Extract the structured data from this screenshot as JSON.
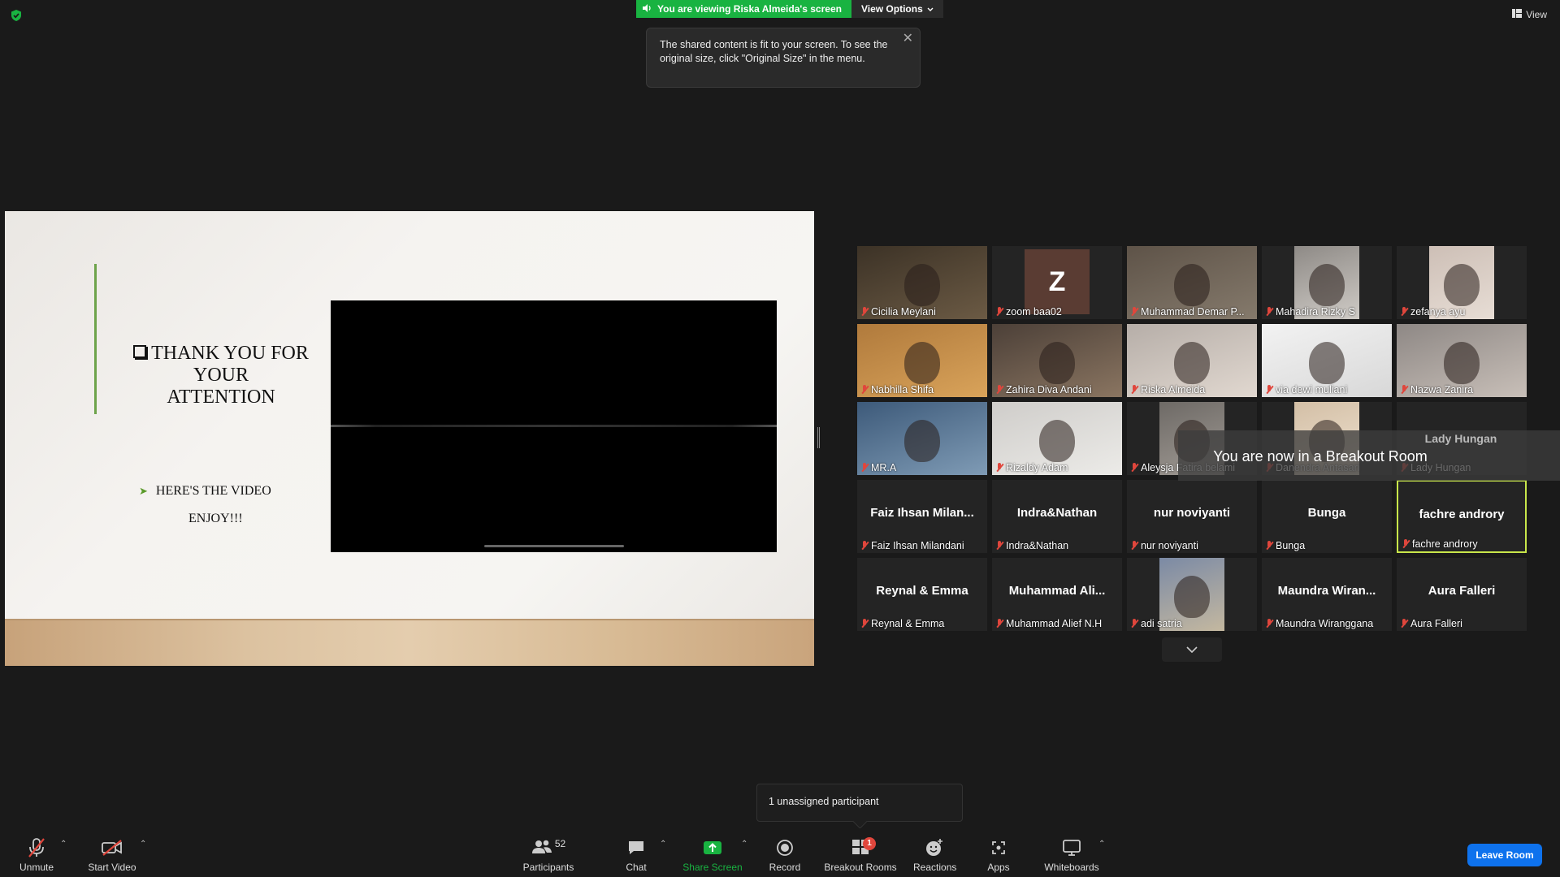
{
  "top": {
    "banner_text": "You are viewing Riska Almeida's screen",
    "view_options_label": "View Options",
    "view_label": "View"
  },
  "tooltip": {
    "text": "The shared content is fit to your screen. To see the original size, click \"Original Size\" in the menu."
  },
  "slide": {
    "title_lines": [
      "THANK YOU FOR",
      "YOUR",
      "ATTENTION"
    ],
    "bullet_text": "HERE'S THE VIDEO",
    "enjoy_text": "ENJOY!!!"
  },
  "gallery": {
    "participants": [
      {
        "name": "Cicilia Meylani",
        "kind": "video"
      },
      {
        "name": "zoom baa02",
        "kind": "letter",
        "letter": "Z"
      },
      {
        "name": "Muhammad Demar P...",
        "kind": "video"
      },
      {
        "name": "Mahadira Rizky S",
        "kind": "video"
      },
      {
        "name": "zefanya ayu",
        "kind": "video"
      },
      {
        "name": "Nabhilla Shifa",
        "kind": "video"
      },
      {
        "name": "Zahira Diva Andani",
        "kind": "video"
      },
      {
        "name": "Riska Almeida",
        "kind": "video"
      },
      {
        "name": "via dewi muliani",
        "kind": "video"
      },
      {
        "name": "Nazwa Zanira",
        "kind": "video"
      },
      {
        "name": "MR.A",
        "kind": "video"
      },
      {
        "name": "Rizaldy Adam",
        "kind": "video"
      },
      {
        "name": "Aleysja Fatira belami",
        "kind": "video"
      },
      {
        "name": "Danendra Antasari",
        "kind": "video"
      },
      {
        "name": "Lady Hungan",
        "kind": "text",
        "big": "Lady Hungan"
      },
      {
        "name": "Faiz Ihsan Milandani",
        "kind": "text",
        "big": "Faiz Ihsan Milan..."
      },
      {
        "name": "Indra&Nathan",
        "kind": "text",
        "big": "Indra&Nathan"
      },
      {
        "name": "nur noviyanti",
        "kind": "text",
        "big": "nur noviyanti"
      },
      {
        "name": "Bunga",
        "kind": "text",
        "big": "Bunga"
      },
      {
        "name": "fachre androry",
        "kind": "text",
        "big": "fachre androry",
        "active": true
      },
      {
        "name": "Reynal & Emma",
        "kind": "text",
        "big": "Reynal & Emma"
      },
      {
        "name": "Muhammad Alief N.H",
        "kind": "text",
        "big": "Muhammad Ali..."
      },
      {
        "name": "adi satria",
        "kind": "video"
      },
      {
        "name": "Maundra Wiranggana",
        "kind": "text",
        "big": "Maundra Wiran..."
      },
      {
        "name": "Aura Falleri",
        "kind": "text",
        "big": "Aura Falleri"
      }
    ],
    "breakout_message": "You are now in a Breakout Room"
  },
  "unassigned": {
    "text": "1 unassigned participant"
  },
  "toolbar": {
    "unmute": "Unmute",
    "start_video": "Start Video",
    "participants": "Participants",
    "participants_count": "52",
    "chat": "Chat",
    "share_screen": "Share Screen",
    "record": "Record",
    "breakout_rooms": "Breakout Rooms",
    "breakout_badge": "1",
    "reactions": "Reactions",
    "apps": "Apps",
    "whiteboards": "Whiteboards",
    "leave_room": "Leave Room"
  },
  "colors": {
    "share_green": "#19b341",
    "leave_blue": "#0e72ed",
    "muted_red": "#e0463c",
    "active_speaker": "#c8e64a"
  }
}
